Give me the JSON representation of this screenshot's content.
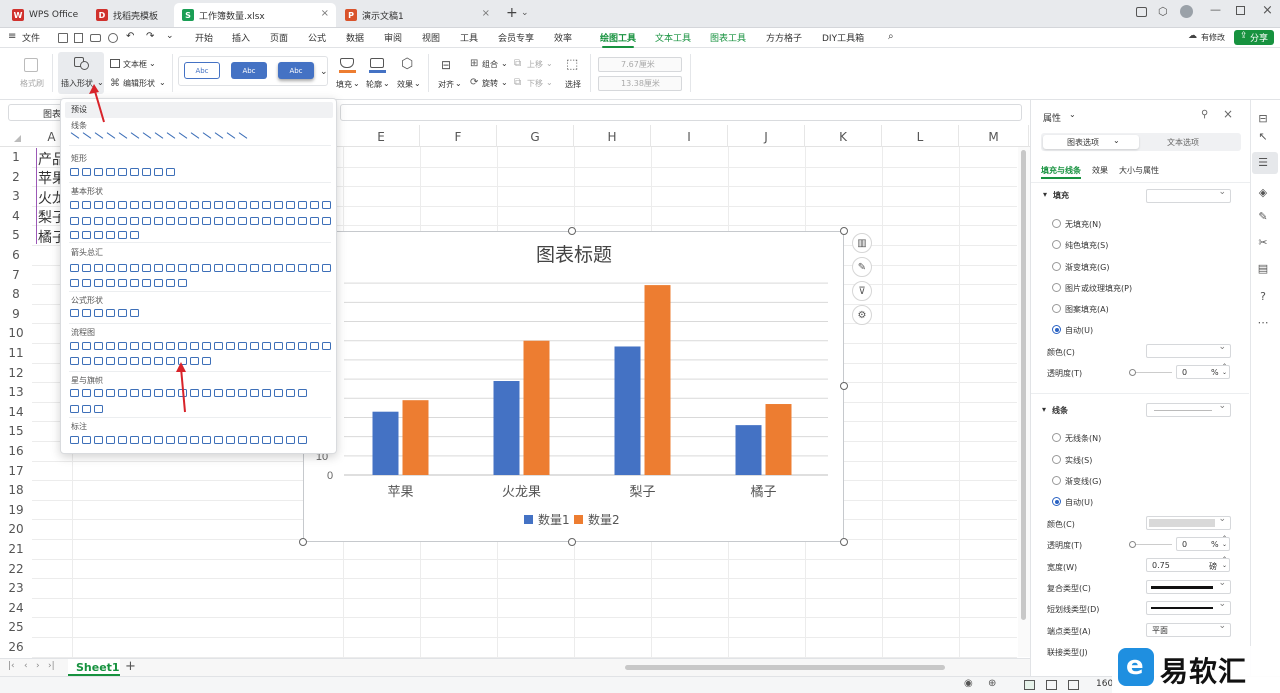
{
  "tabs": [
    {
      "label": "WPS Office",
      "icon": "wps-logo-icon",
      "color": "#d0312d"
    },
    {
      "label": "找稻壳模板",
      "icon": "docer-icon",
      "color": "#d0312d"
    },
    {
      "label": "工作簿数量.xlsx",
      "icon": "spreadsheet-icon",
      "color": "#1a9e55",
      "active": true
    },
    {
      "label": "演示文稿1",
      "icon": "presentation-icon",
      "color": "#d9532b"
    }
  ],
  "menu": {
    "file": "文件",
    "items": [
      "开始",
      "插入",
      "页面",
      "公式",
      "数据",
      "审阅",
      "视图",
      "工具",
      "会员专享",
      "效率"
    ],
    "context": [
      "绘图工具",
      "文本工具",
      "图表工具"
    ],
    "extra": [
      "方方格子",
      "DIY工具箱"
    ],
    "has_changes": "有修改",
    "share": "分享"
  },
  "ribbon": {
    "format_painter": "格式刷",
    "insert_shape": "插入形状",
    "textbox": "文本框",
    "edit_shape": "编辑形状",
    "style_samples": [
      "Abc",
      "Abc",
      "Abc"
    ],
    "fill": "填充",
    "outline": "轮廓",
    "effect": "效果",
    "align": "对齐",
    "group": "组合",
    "rotate": "旋转",
    "up": "上移",
    "down": "下移",
    "select": "选择",
    "height": "7.67厘米",
    "width": "13.38厘米"
  },
  "namebox": "图表",
  "sheet": {
    "columns": [
      "E",
      "F",
      "G",
      "H",
      "I",
      "J",
      "K",
      "L",
      "M"
    ],
    "first_col": "A",
    "rows": [
      "1",
      "2",
      "3",
      "4",
      "5",
      "6",
      "7",
      "8",
      "9",
      "10",
      "11",
      "12",
      "13",
      "14",
      "15",
      "16",
      "17",
      "18",
      "19",
      "20",
      "21",
      "22",
      "23",
      "24",
      "25",
      "26"
    ],
    "cells": [
      "产品",
      "苹果",
      "火龙果",
      "梨子",
      "橘子"
    ],
    "tab": "Sheet1"
  },
  "chart_data": {
    "type": "bar",
    "title": "图表标题",
    "categories": [
      "苹果",
      "火龙果",
      "梨子",
      "橘子"
    ],
    "series": [
      {
        "name": "数量1",
        "values": [
          33,
          49,
          67,
          26
        ],
        "color": "#4472c4"
      },
      {
        "name": "数量2",
        "values": [
          39,
          70,
          99,
          37
        ],
        "color": "#ed7d31"
      }
    ],
    "ylim": [
      0,
      110
    ],
    "visible_ticks": [
      "10",
      "0"
    ],
    "legend": "bottom",
    "grid": true
  },
  "dropdown": {
    "header": "预设",
    "sections": [
      "线条",
      "矩形",
      "基本形状",
      "箭头总汇",
      "公式形状",
      "流程图",
      "星与旗帜",
      "标注"
    ]
  },
  "panel": {
    "title": "属性",
    "tab_chart": "图表选项",
    "tab_text": "文本选项",
    "subtabs": [
      "填充与线条",
      "效果",
      "大小与属性"
    ],
    "fill_heading": "填充",
    "fill_options": [
      "无填充(N)",
      "纯色填充(S)",
      "渐变填充(G)",
      "图片或纹理填充(P)",
      "图案填充(A)",
      "自动(U)"
    ],
    "color_label": "颜色(C)",
    "transparency_label": "透明度(T)",
    "transparency_value": "0",
    "percent": "%",
    "line_heading": "线条",
    "line_options": [
      "无线条(N)",
      "实线(S)",
      "渐变线(G)",
      "自动(U)"
    ],
    "line_color_label": "颜色(C)",
    "line_transparency_label": "透明度(T)",
    "line_transparency_value": "0",
    "width_label": "宽度(W)",
    "width_value": "0.75",
    "width_unit": "磅",
    "compound_label": "复合类型(C)",
    "dash_label": "短划线类型(D)",
    "cap_label": "端点类型(A)",
    "cap_value": "平面",
    "join_label": "联接类型(J)"
  },
  "status": {
    "zoom": "160"
  },
  "watermark": "易软汇"
}
